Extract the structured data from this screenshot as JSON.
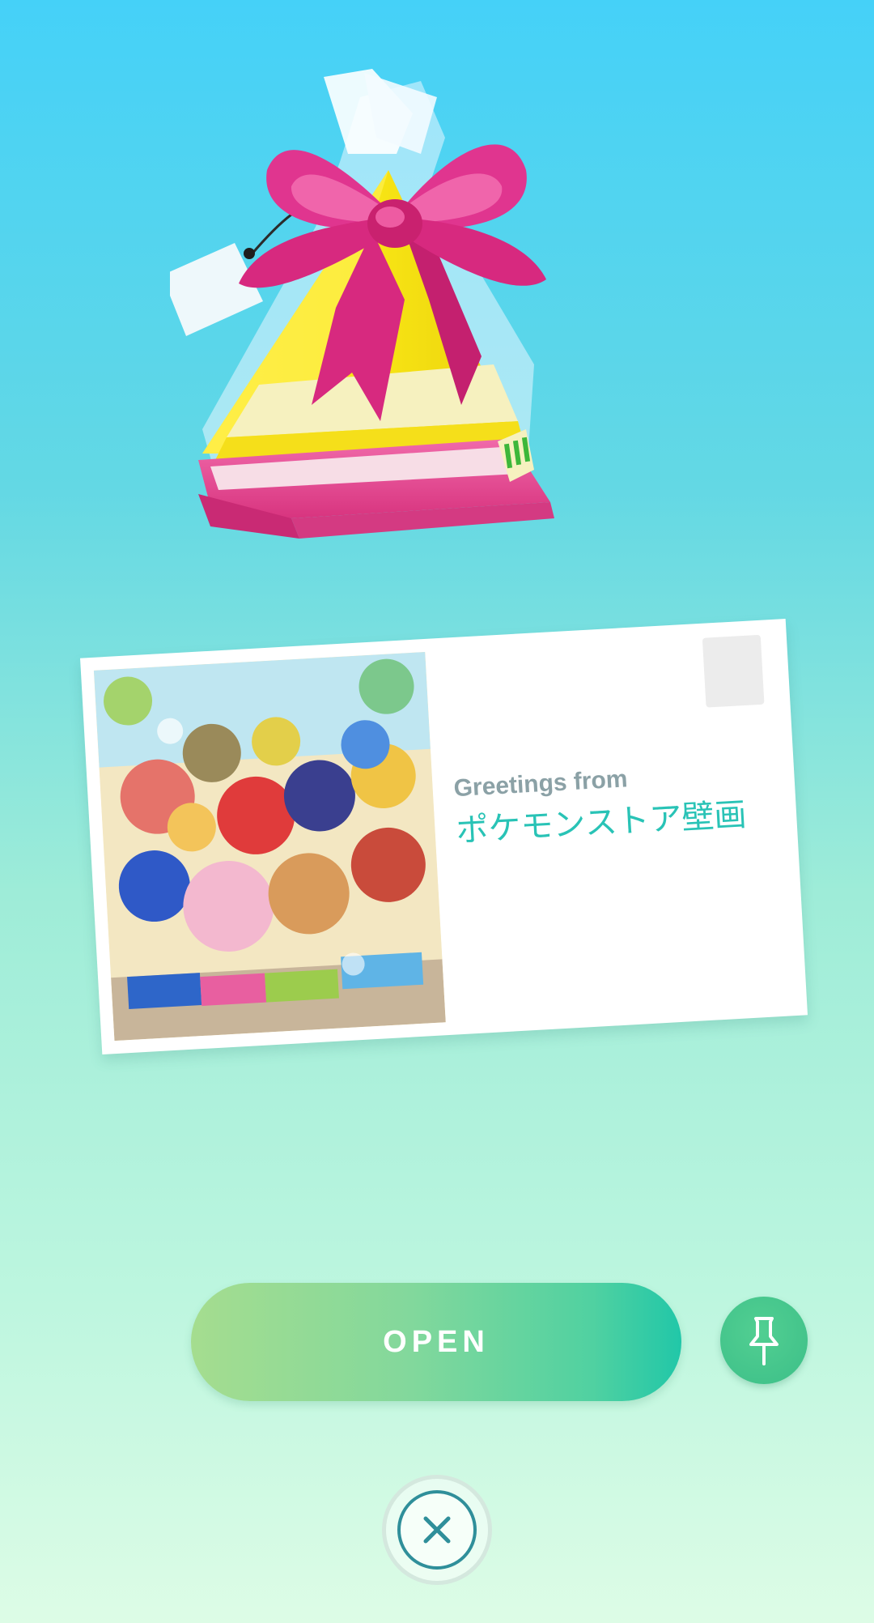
{
  "postcard": {
    "greeting_prefix": "Greetings from",
    "location_name": "ポケモンストア壁画"
  },
  "actions": {
    "open_label": "OPEN",
    "pin_icon": "pin-icon",
    "close_icon": "close-icon"
  },
  "gift": {
    "icon": "gift-icon",
    "colors": {
      "ribbon": "#e0358f",
      "body": "#f5e315",
      "band": "#f6f1bf",
      "base": "#e84d9b"
    }
  },
  "colors": {
    "sky_top": "#45d1f8",
    "mint_bottom": "#ddfce6",
    "location_text": "#29c3b6",
    "open_button_start": "#a5dd8f",
    "open_button_end": "#21c7a8"
  }
}
